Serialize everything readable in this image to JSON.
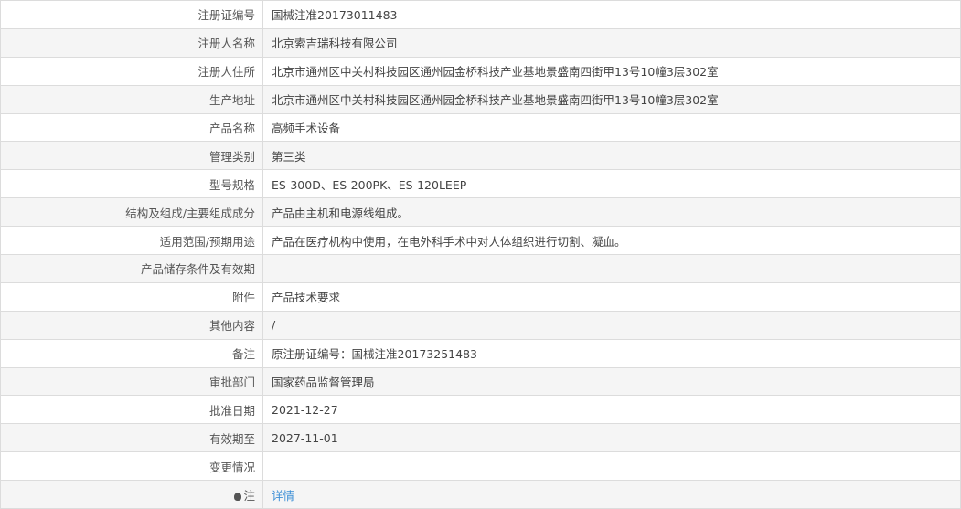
{
  "rows": [
    {
      "label": "注册证编号",
      "value": "国械注准20173011483"
    },
    {
      "label": "注册人名称",
      "value": "北京索吉瑞科技有限公司"
    },
    {
      "label": "注册人住所",
      "value": "北京市通州区中关村科技园区通州园金桥科技产业基地景盛南四街甲13号10幢3层302室"
    },
    {
      "label": "生产地址",
      "value": "北京市通州区中关村科技园区通州园金桥科技产业基地景盛南四街甲13号10幢3层302室"
    },
    {
      "label": "产品名称",
      "value": "高频手术设备"
    },
    {
      "label": "管理类别",
      "value": "第三类"
    },
    {
      "label": "型号规格",
      "value": "ES-300D、ES-200PK、ES-120LEEP"
    },
    {
      "label": "结构及组成/主要组成成分",
      "value": "产品由主机和电源线组成。"
    },
    {
      "label": "适用范围/预期用途",
      "value": "产品在医疗机构中使用，在电外科手术中对人体组织进行切割、凝血。"
    },
    {
      "label": "产品储存条件及有效期",
      "value": ""
    },
    {
      "label": "附件",
      "value": "产品技术要求"
    },
    {
      "label": "其他内容",
      "value": "/"
    },
    {
      "label": "备注",
      "value": "原注册证编号：国械注准20173251483"
    },
    {
      "label": "审批部门",
      "value": "国家药品监督管理局"
    },
    {
      "label": "批准日期",
      "value": "2021-12-27"
    },
    {
      "label": "有效期至",
      "value": "2027-11-01"
    },
    {
      "label": "变更情况",
      "value": ""
    }
  ],
  "note": {
    "label": "注",
    "link": "详情",
    "icon": "lightbulb-icon",
    "link_color": "#3d8fd6"
  }
}
